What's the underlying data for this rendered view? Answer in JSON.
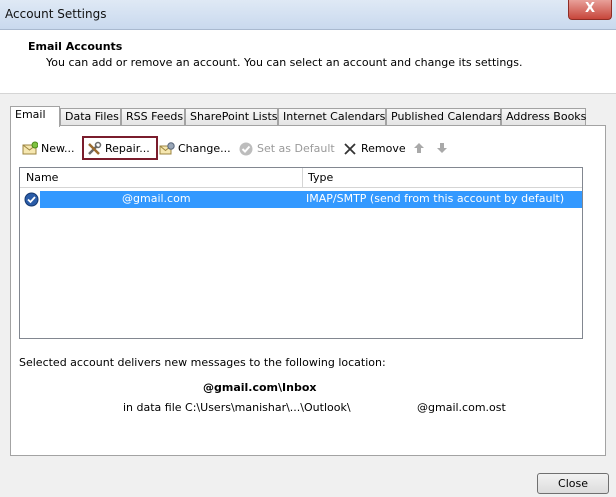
{
  "window": {
    "title": "Account Settings",
    "close_glyph": "X"
  },
  "header": {
    "title": "Email Accounts",
    "description": "You can add or remove an account. You can select an account and change its settings."
  },
  "tabs": [
    {
      "label": "Email"
    },
    {
      "label": "Data Files"
    },
    {
      "label": "RSS Feeds"
    },
    {
      "label": "SharePoint Lists"
    },
    {
      "label": "Internet Calendars"
    },
    {
      "label": "Published Calendars"
    },
    {
      "label": "Address Books"
    }
  ],
  "toolbar": {
    "new_label": "New...",
    "repair_label": "Repair...",
    "change_label": "Change...",
    "set_default_label": "Set as Default",
    "remove_label": "Remove"
  },
  "list": {
    "headers": {
      "name": "Name",
      "type": "Type"
    },
    "rows": [
      {
        "name": "@gmail.com",
        "type": "IMAP/SMTP (send from this account by default)"
      }
    ]
  },
  "delivery": {
    "caption": "Selected account delivers new messages to the following location:",
    "folder": "@gmail.com\\Inbox",
    "file_prefix": "in data file C:\\Users\\manishar\\...\\Outlook\\",
    "file_suffix": "@gmail.com.ost"
  },
  "footer": {
    "close_label": "Close"
  },
  "colors": {
    "selection": "#3399ff",
    "highlight_border": "#7a1c2c"
  }
}
